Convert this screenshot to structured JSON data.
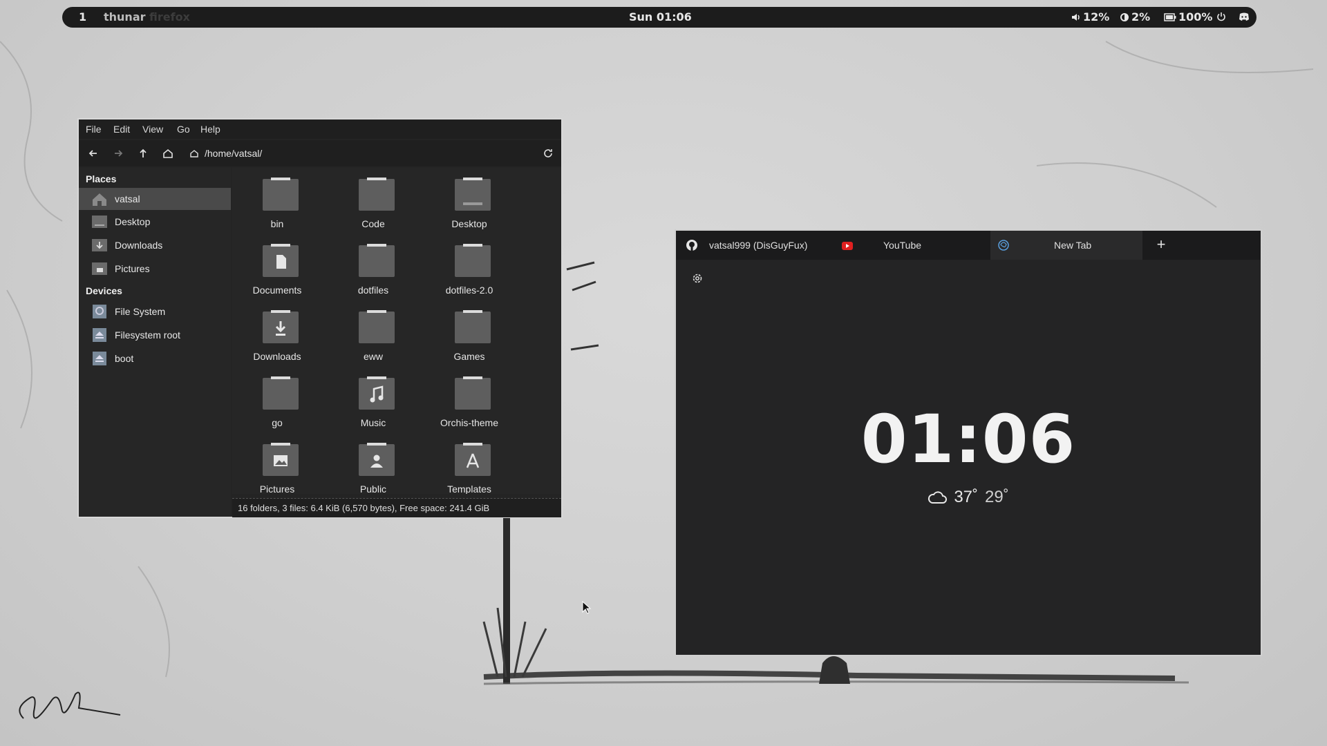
{
  "topbar": {
    "workspace": "1",
    "apps": [
      "thunar",
      "firefox"
    ],
    "clock": "Sun  01:06",
    "volume": "12%",
    "brightness": "2%",
    "battery": "100%"
  },
  "thunar": {
    "menu": [
      "File",
      "Edit",
      "View",
      "Go",
      "Help"
    ],
    "path": "/home/vatsal/",
    "sidebar": {
      "places_heading": "Places",
      "places": [
        "vatsal",
        "Desktop",
        "Downloads",
        "Pictures"
      ],
      "devices_heading": "Devices",
      "devices": [
        "File System",
        "Filesystem root",
        "boot"
      ]
    },
    "files": [
      "bin",
      "Code",
      "Desktop",
      "Documents",
      "dotfiles",
      "dotfiles-2.0",
      "Downloads",
      "eww",
      "Games",
      "go",
      "Music",
      "Orchis-theme",
      "Pictures",
      "Public",
      "Templates"
    ],
    "status": "16 folders, 3 files: 6.4 KiB (6,570 bytes), Free space: 241.4 GiB"
  },
  "firefox": {
    "tabs": [
      "vatsal999 (DisGuyFux)",
      "YouTube",
      "New Tab"
    ],
    "newtab_clock": "01:06",
    "weather_high": "37˚",
    "weather_low": "29˚"
  }
}
